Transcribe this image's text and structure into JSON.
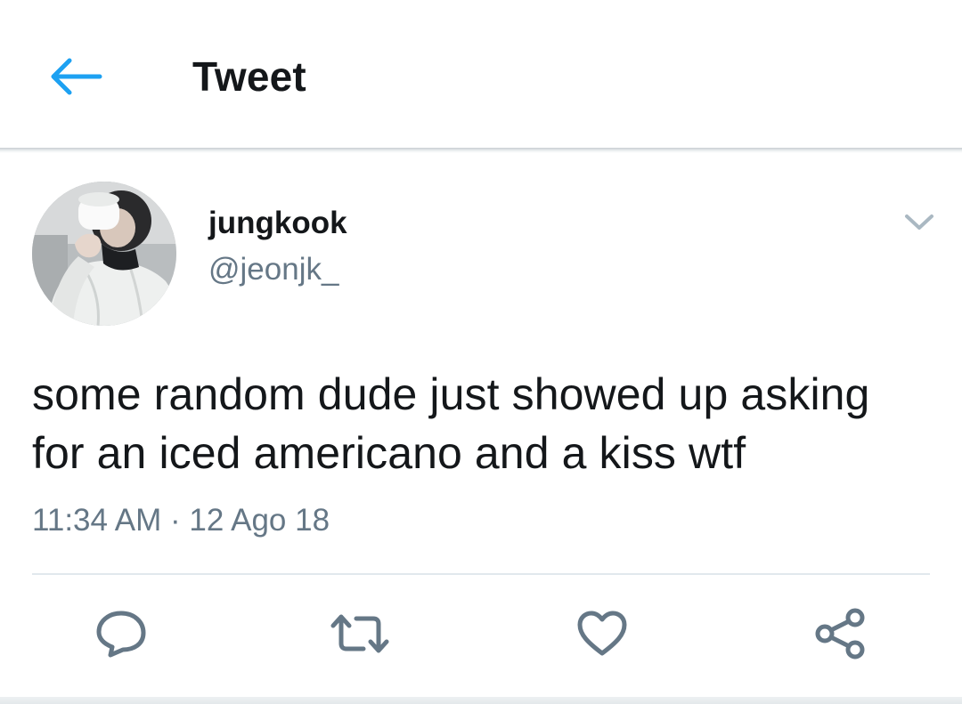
{
  "header": {
    "title": "Tweet",
    "back_icon": "arrow-left-icon",
    "accent_color": "#1da1f2"
  },
  "tweet": {
    "author": {
      "display_name": "jungkook",
      "handle": "@jeonjk_"
    },
    "text": "some random dude just showed up asking for an iced americano and a kiss wtf",
    "timestamp": "11:34 AM · 12 Ago 18",
    "menu_icon": "chevron-down-icon"
  },
  "actions": [
    {
      "name": "reply",
      "icon": "reply-icon"
    },
    {
      "name": "retweet",
      "icon": "retweet-icon"
    },
    {
      "name": "like",
      "icon": "heart-icon"
    },
    {
      "name": "share",
      "icon": "share-icon"
    }
  ],
  "colors": {
    "primary_text": "#14171a",
    "secondary_text": "#657786",
    "icon_gray": "#657786",
    "divider": "#e1e8ed"
  }
}
